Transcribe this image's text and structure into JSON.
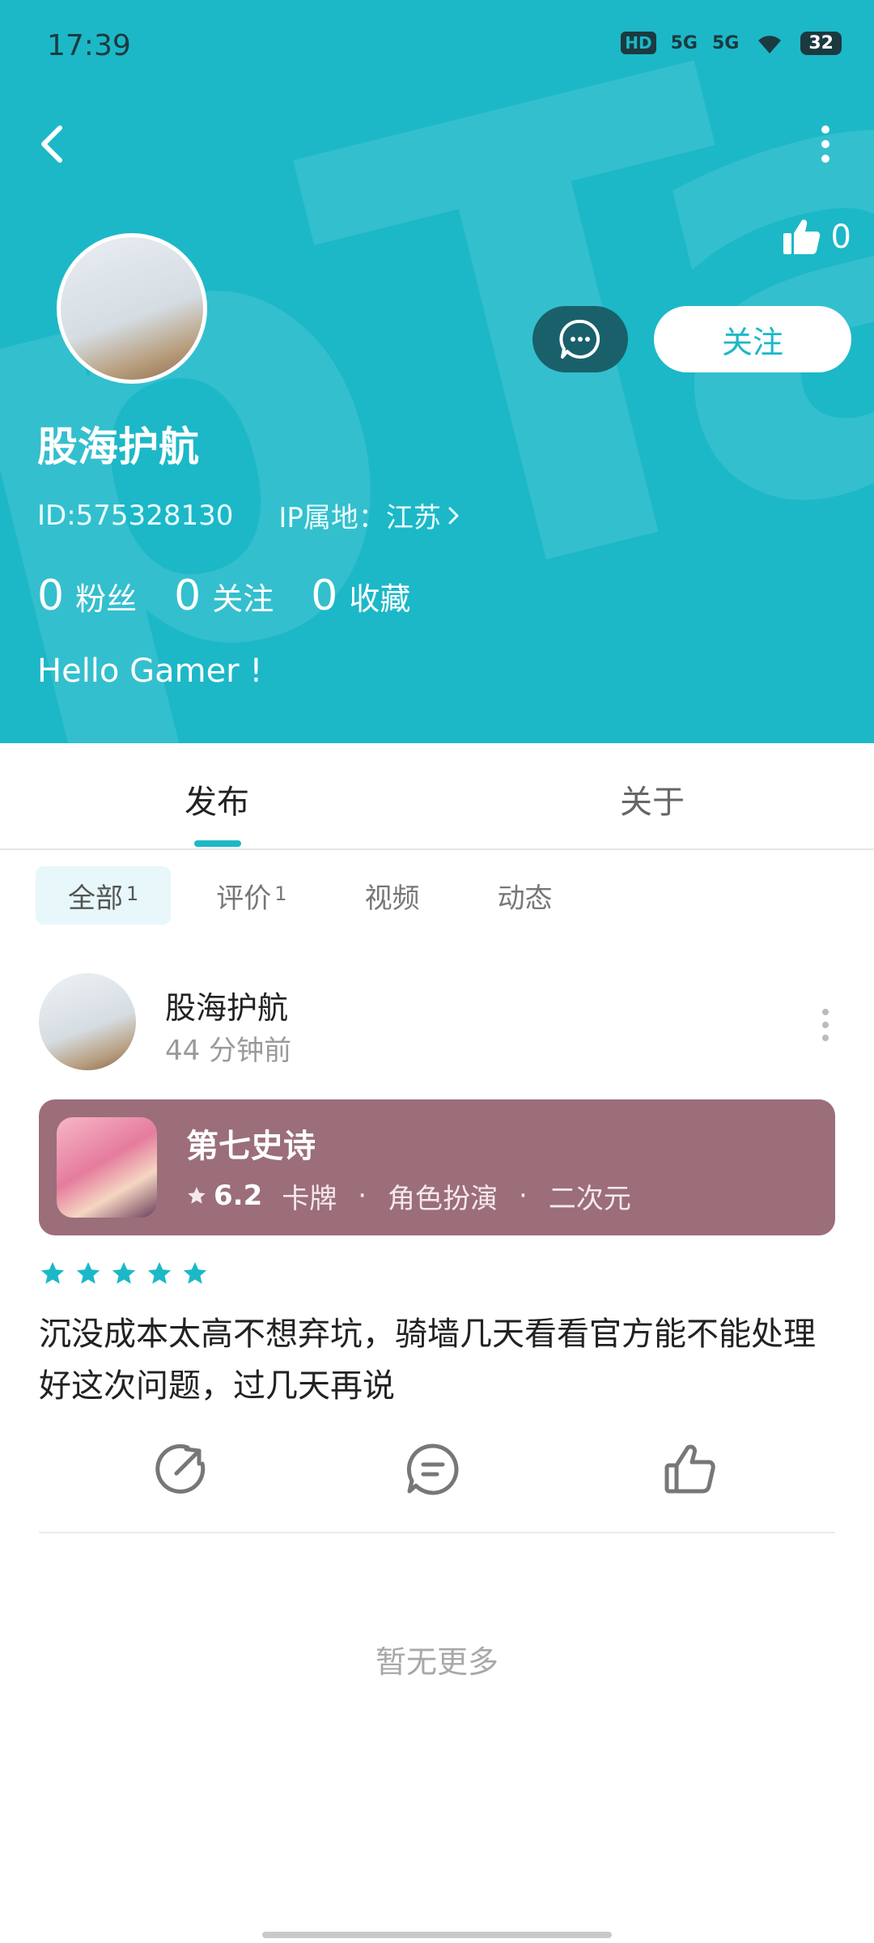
{
  "status_bar": {
    "time": "17:39",
    "network1": "5G",
    "network2": "5G",
    "hd": "HD",
    "battery": "32"
  },
  "profile": {
    "like_count": "0",
    "follow_label": "关注",
    "username": "股海护航",
    "id_text": "ID:575328130",
    "ip_text": "IP属地：江苏",
    "stats": [
      {
        "num": "0",
        "label": "粉丝"
      },
      {
        "num": "0",
        "label": "关注"
      },
      {
        "num": "0",
        "label": "收藏"
      }
    ],
    "bio": "Hello Gamer !"
  },
  "tabs": {
    "active": "发布",
    "inactive": "关于"
  },
  "filters": [
    {
      "label": "全部",
      "count": "1"
    },
    {
      "label": "评价",
      "count": "1"
    },
    {
      "label": "视频",
      "count": ""
    },
    {
      "label": "动态",
      "count": ""
    }
  ],
  "post": {
    "author": "股海护航",
    "time": "44 分钟前",
    "game": {
      "title": "第七史诗",
      "rating": "6.2",
      "tags": [
        "卡牌",
        "角色扮演",
        "二次元"
      ]
    },
    "stars": 5,
    "review": "沉没成本太高不想弃坑，骑墙几天看看官方能不能处理好这次问题，过几天再说"
  },
  "end_text": "暂无更多",
  "colors": {
    "accent": "#1cb8c8",
    "message_btn": "#19606b",
    "game_card": "#9b6e7a"
  }
}
